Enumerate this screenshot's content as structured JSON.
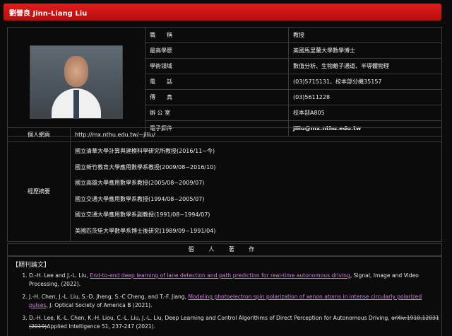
{
  "title": "劉晉良 Jinn-Liang Liu",
  "profile": [
    {
      "label": "職　　稱",
      "value": "教授"
    },
    {
      "label": "最高學歷",
      "value": "美國馬里蘭大學數學博士"
    },
    {
      "label": "學術領域",
      "value": "數值分析、生物離子通道、半導體物理"
    },
    {
      "label": "電　　話",
      "value": "(03)5715131、校本部分機35157"
    },
    {
      "label": "傳　　真",
      "value": "(03)5611228"
    },
    {
      "label": "辦 公 室",
      "value": "校本部A805"
    },
    {
      "label": "電子郵件",
      "value": "jlliu@mx.nthu.edu.tw"
    }
  ],
  "homepage": {
    "label": "個人網頁",
    "value": "http://mx.nthu.edu.tw/~jlliu/"
  },
  "experience": {
    "label": "經歷摘要",
    "items": [
      "國立清華大學計算與建模科學研究所教授(2016/11~今)",
      "國立新竹教育大學應用數學系教授(2009/08~2016/10)",
      "國立高雄大學應用數學系教授(2005/08~2009/07)",
      "國立交通大學應用數學系教授(1994/08~2005/07)",
      "國立交通大學應用數學系副教授(1991/08~1994/07)",
      "美國匹茨堡大學數學系博士後研究(1989/09~1991/04)"
    ]
  },
  "works_header": "個 人 著 作",
  "publications": {
    "heading": "【期刊論文】",
    "items": [
      {
        "pre": "D.-H. Lee and J.-L. Liu, ",
        "link": "End-to-end deep learning of lane detection and path prediction for real-time autonomous driving",
        "post": ", Signal, Image and Video Processing, (2022)."
      },
      {
        "pre": "J.-H. Chen, J.-L. Liu, S.-D. Jheng, S.-C Cheng, and T.-F. Jiang, ",
        "link": "Modeling photoelectron spin polarization of xenon atoms in intense circularly polarized pulses",
        "post": ", J. Optical Society of America B (2021)."
      },
      {
        "pre": "D.-H. Lee, K.-L. Chen, K.-H. Liou, C.-L. Liu, J.-L. Liu, Deep Learning and Control Algorithms of Direct Perception for Autonomous Driving, ",
        "strike": "arXiv:1910.12031 (2019)",
        "post": "Applied Intelligence 51, 237-247 (2021)."
      }
    ]
  }
}
